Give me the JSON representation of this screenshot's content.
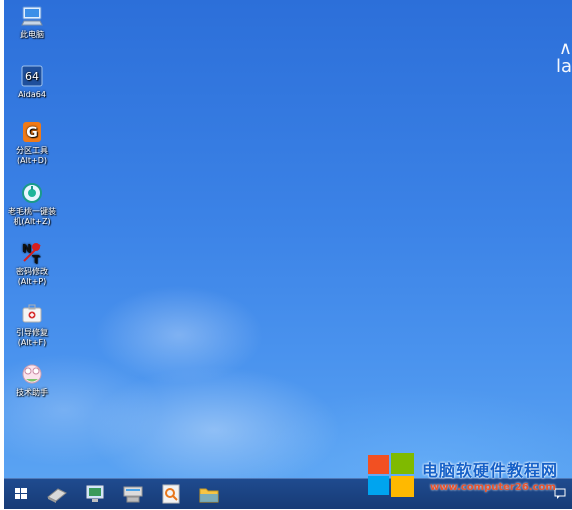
{
  "desktop": {
    "brand_mark": "∧\nla",
    "icons": [
      {
        "name": "this-pc",
        "label": "此电脑"
      },
      {
        "name": "aida64",
        "label": "Aida64"
      },
      {
        "name": "partition-tool",
        "label": "分区工具\n(Alt+D)"
      },
      {
        "name": "one-key-restore",
        "label": "老毛桃一键装\n机(Alt+Z)"
      },
      {
        "name": "password-reset",
        "label": "密码修改\n(Alt+P)"
      },
      {
        "name": "boot-repair",
        "label": "引导修复\n(Alt+F)"
      },
      {
        "name": "more-tools",
        "label": "技术助手"
      }
    ]
  },
  "taskbar": {
    "buttons": [
      "start-icon",
      "drive-icon",
      "monitor-icon",
      "network-icon",
      "search-tool-icon",
      "folder-icon"
    ]
  },
  "watermark": {
    "title": "电脑软硬件教程网",
    "url": "www.computer26.com",
    "logo_colors": [
      "#f25022",
      "#7fba00",
      "#00a4ef",
      "#ffb900"
    ]
  },
  "colors": {
    "desktop_top": "#2c6fd9",
    "desktop_bottom": "#5aa3f2",
    "taskbar": "#173b76"
  }
}
